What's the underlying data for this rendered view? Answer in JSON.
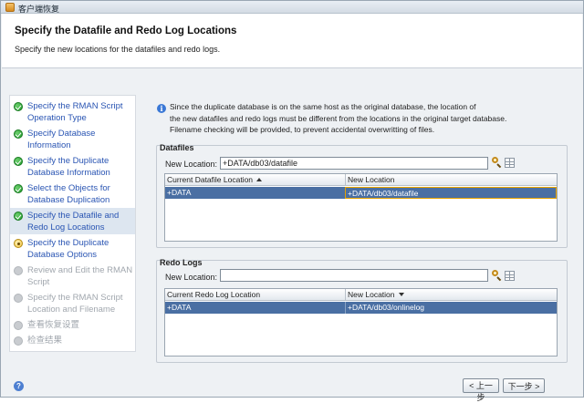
{
  "window": {
    "title": "客户端恢复"
  },
  "header": {
    "title": "Specify the Datafile and Redo Log Locations",
    "subtitle": "Specify the new locations for the datafiles and redo logs."
  },
  "nav": {
    "items": [
      {
        "label": "Specify the RMAN Script Operation Type",
        "state": "done"
      },
      {
        "label": "Specify Database Information",
        "state": "done"
      },
      {
        "label": "Specify the Duplicate Database Information",
        "state": "done"
      },
      {
        "label": "Select the Objects for Database Duplication",
        "state": "done"
      },
      {
        "label": "Specify the Datafile and Redo Log Locations",
        "state": "done"
      },
      {
        "label": "Specify the Duplicate Database Options",
        "state": "active"
      },
      {
        "label": "Review and Edit the RMAN Script",
        "state": "pending"
      },
      {
        "label": "Specify the RMAN Script Location and Filename",
        "state": "pending"
      },
      {
        "label": "查看恢复设置",
        "state": "pending"
      },
      {
        "label": "检查结果",
        "state": "pending"
      }
    ]
  },
  "info": {
    "lines": [
      "Since the duplicate database is on the same host as the original database, the location of",
      "the new datafiles and redo logs must be different from the locations in the original target database.",
      "Filename checking will be provided, to prevent accidental overwritting of files."
    ]
  },
  "datafiles": {
    "group_title": "Datafiles",
    "new_location_label": "New Location:",
    "new_location_value": "+DATA/db03/datafile",
    "columns": [
      "Current Datafile Location",
      "New Location"
    ],
    "rows": [
      {
        "current": "+DATA",
        "new": "+DATA/db03/datafile"
      }
    ]
  },
  "redologs": {
    "group_title": "Redo Logs",
    "new_location_label": "New Location:",
    "new_location_value": "",
    "columns": [
      "Current Redo Log Location",
      "New Location"
    ],
    "rows": [
      {
        "current": "+DATA",
        "new": "+DATA/db03/onlinelog"
      }
    ]
  },
  "footer": {
    "back_label": "< 上一步",
    "next_label": "下一步 >"
  }
}
